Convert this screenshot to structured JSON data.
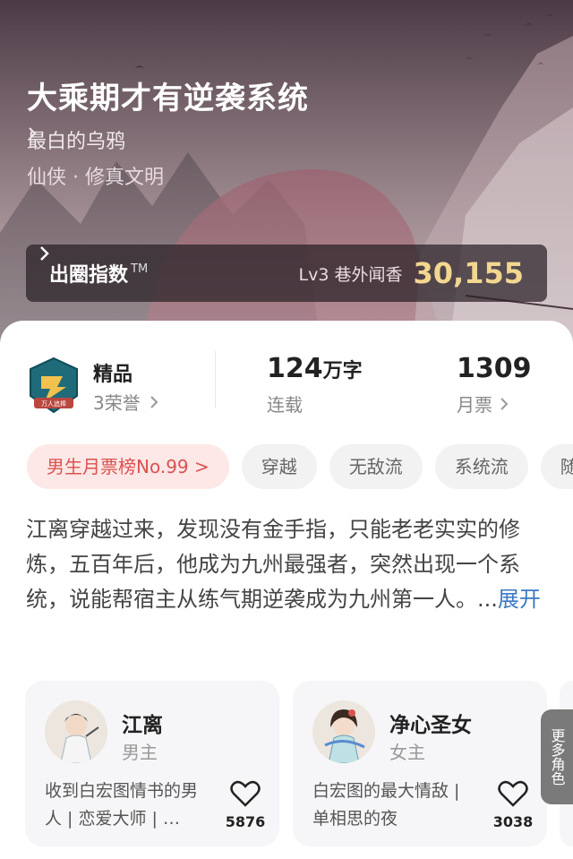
{
  "book": {
    "title": "大乘期才有逆袭系统",
    "author": "最白的乌鸦",
    "genre": "仙侠 · 修真文明"
  },
  "index": {
    "label": "出圈指数",
    "tm": "TM",
    "level": "Lv3 巷外闻香",
    "value": "30,155",
    "chevron": "›"
  },
  "stats": {
    "quality": "精品",
    "honor": "3荣誉",
    "badge_text": "万人追捧",
    "words_number": "124",
    "words_unit": "万字",
    "status": "连载",
    "monthly_votes": "1309",
    "monthly_votes_label": "月票"
  },
  "tags": [
    "男生月票榜No.99 >",
    "穿越",
    "无敌流",
    "系统流",
    "随"
  ],
  "synopsis": {
    "text": "江离穿越过来，发现没有金手指，只能老老实实的修炼，五百年后，他成为九州最强者，突然出现一个系统，说能帮宿主从练气期逆袭成为九州第一人。...",
    "expand": "展开"
  },
  "characters": [
    {
      "name": "江离",
      "role": "男主",
      "desc": "收到白宏图情书的男人 | 恋爱大师 | …",
      "likes": "5876"
    },
    {
      "name": "净心圣女",
      "role": "女主",
      "desc": "白宏图的最大情敌 | 单相思的夜",
      "likes": "3038"
    }
  ],
  "more_roles": "更多角色",
  "colors": {
    "accent_gold": "#f3d690",
    "rank_red": "#d9534f",
    "link_blue": "#3a78c2"
  }
}
